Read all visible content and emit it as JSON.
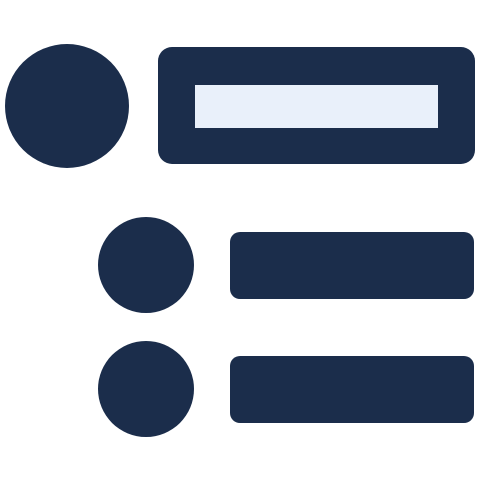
{
  "icon": {
    "name": "hierarchical-list-icon",
    "colors": {
      "primary": "#1b2d4b",
      "highlight": "#e9f0fa",
      "background": "#ffffff"
    },
    "rows": [
      {
        "level": "parent",
        "selected": true
      },
      {
        "level": "child",
        "selected": false
      },
      {
        "level": "child",
        "selected": false
      }
    ]
  }
}
